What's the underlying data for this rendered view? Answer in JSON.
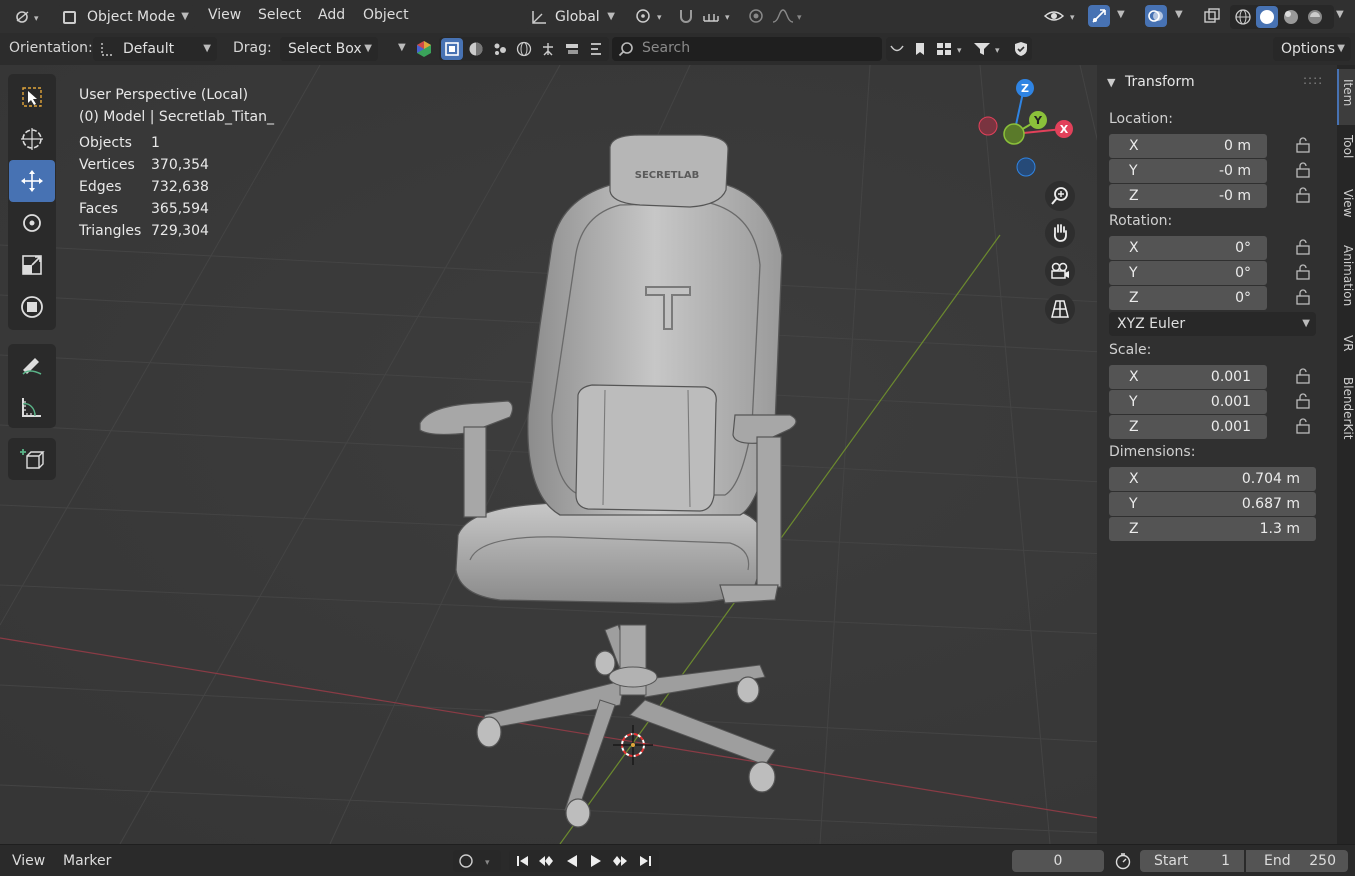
{
  "header": {
    "mode_label": "Object Mode",
    "menus": [
      "View",
      "Select",
      "Add",
      "Object"
    ],
    "transform_orientation": "Global"
  },
  "toolbar": {
    "orientation_label": "Orientation:",
    "orientation_value": "Default",
    "drag_label": "Drag:",
    "drag_value": "Select Box",
    "search_placeholder": "Search",
    "options_label": "Options"
  },
  "viewport": {
    "perspective_label": "User Perspective (Local)",
    "context_label": "(0) Model | Secretlab_Titan_",
    "stats": [
      {
        "label": "Objects",
        "value": "1"
      },
      {
        "label": "Vertices",
        "value": "370,354"
      },
      {
        "label": "Edges",
        "value": "732,638"
      },
      {
        "label": "Faces",
        "value": "365,594"
      },
      {
        "label": "Triangles",
        "value": "729,304"
      }
    ],
    "gizmo": {
      "x": "X",
      "y": "Y",
      "z": "Z"
    },
    "model_logo_text": "SECRETLAB"
  },
  "sidebar": {
    "panel_title": "Transform",
    "location_label": "Location:",
    "location": [
      {
        "axis": "X",
        "value": "0 m"
      },
      {
        "axis": "Y",
        "value": "-0 m"
      },
      {
        "axis": "Z",
        "value": "-0 m"
      }
    ],
    "rotation_label": "Rotation:",
    "rotation": [
      {
        "axis": "X",
        "value": "0°"
      },
      {
        "axis": "Y",
        "value": "0°"
      },
      {
        "axis": "Z",
        "value": "0°"
      }
    ],
    "rotation_mode": "XYZ Euler",
    "scale_label": "Scale:",
    "scale": [
      {
        "axis": "X",
        "value": "0.001"
      },
      {
        "axis": "Y",
        "value": "0.001"
      },
      {
        "axis": "Z",
        "value": "0.001"
      }
    ],
    "dimensions_label": "Dimensions:",
    "dimensions": [
      {
        "axis": "X",
        "value": "0.704 m"
      },
      {
        "axis": "Y",
        "value": "0.687 m"
      },
      {
        "axis": "Z",
        "value": "1.3 m"
      }
    ],
    "tabs": [
      "Item",
      "Tool",
      "View",
      "Animation",
      "VR",
      "BlenderKit"
    ]
  },
  "timeline": {
    "view_label": "View",
    "marker_label": "Marker",
    "current_frame": "0",
    "start_label": "Start",
    "start_value": "1",
    "end_label": "End",
    "end_value": "250"
  },
  "colors": {
    "accent": "#4772b3",
    "axis_x": "#e2415a",
    "axis_y": "#8bc13a",
    "axis_z": "#2f84e3"
  }
}
